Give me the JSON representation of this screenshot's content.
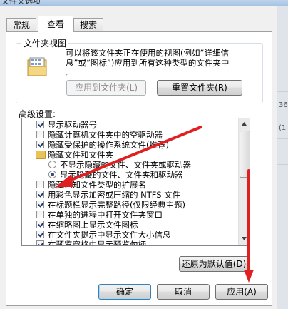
{
  "window": {
    "title": "文件夹选项"
  },
  "tabs": [
    {
      "label": "常规",
      "active": false
    },
    {
      "label": "查看",
      "active": true
    },
    {
      "label": "搜索",
      "active": false
    }
  ],
  "folder_views": {
    "title": "文件夹视图",
    "icon": "folder-view-icon",
    "description_line1": "可以将该文件夹正在使用的视图(例如“详细信",
    "description_line2": "息”或“图标”)应用到所有这种类型的文件夹中",
    "description_line3": "。",
    "apply_button": "应用到文件夹(L)",
    "reset_button": "重置文件夹(R)"
  },
  "advanced": {
    "label": "高级设置:",
    "items": [
      {
        "type": "checkbox",
        "checked": true,
        "label": "显示驱动器号"
      },
      {
        "type": "checkbox",
        "checked": false,
        "label": "隐藏计算机文件夹中的空驱动器"
      },
      {
        "type": "checkbox",
        "checked": true,
        "label": "隐藏受保护的操作系统文件(推荐)"
      },
      {
        "type": "folder",
        "label": "隐藏文件和文件夹"
      },
      {
        "type": "radio",
        "checked": false,
        "label": "不显示隐藏的文件、文件夹或驱动器"
      },
      {
        "type": "radio",
        "checked": true,
        "label": "显示隐藏的文件、文件夹和驱动器"
      },
      {
        "type": "checkbox",
        "checked": false,
        "label": "隐藏已知文件类型的扩展名"
      },
      {
        "type": "checkbox",
        "checked": true,
        "label": "用彩色显示加密或压缩的 NTFS 文件"
      },
      {
        "type": "checkbox",
        "checked": true,
        "label": "在标题栏显示完整路径(仅限经典主题)"
      },
      {
        "type": "checkbox",
        "checked": false,
        "label": "在单独的进程中打开文件夹窗口"
      },
      {
        "type": "checkbox",
        "checked": true,
        "label": "在缩略图上显示文件图标"
      },
      {
        "type": "checkbox",
        "checked": true,
        "label": "在文件夹提示中显示文件大小信息"
      },
      {
        "type": "checkbox",
        "checked": true,
        "label": "在预览窗格中显示预览句柄"
      }
    ],
    "restore_button": "还原为默认值(D)"
  },
  "footer": {
    "ok": "确定",
    "cancel": "取消",
    "apply": "应用(A)"
  },
  "background_right": {
    "n1": "36",
    "n2": "(1"
  },
  "colors": {
    "annotation_arrow": "#e02020",
    "check_mark": "#1b3b6b"
  }
}
